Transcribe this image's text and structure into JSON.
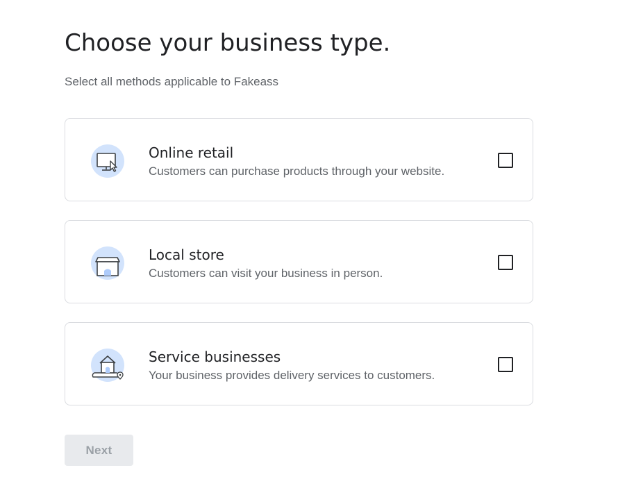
{
  "page": {
    "title": "Choose your business type.",
    "subtitle": "Select all methods applicable to Fakeass"
  },
  "options": [
    {
      "title": "Online retail",
      "description": "Customers can purchase products through your website.",
      "icon": "computer-cursor-icon",
      "checked": false
    },
    {
      "title": "Local store",
      "description": "Customers can visit your business in person.",
      "icon": "storefront-icon",
      "checked": false
    },
    {
      "title": "Service businesses",
      "description": "Your business provides delivery services to customers.",
      "icon": "home-delivery-icon",
      "checked": false
    }
  ],
  "footer": {
    "next_label": "Next",
    "next_enabled": false
  },
  "colors": {
    "illustration_circle": "#d2e3fc",
    "text_primary": "#202124",
    "text_secondary": "#5f6368",
    "card_border": "#dadce0",
    "button_disabled_bg": "#e8eaed",
    "button_disabled_text": "#9aa0a6"
  }
}
